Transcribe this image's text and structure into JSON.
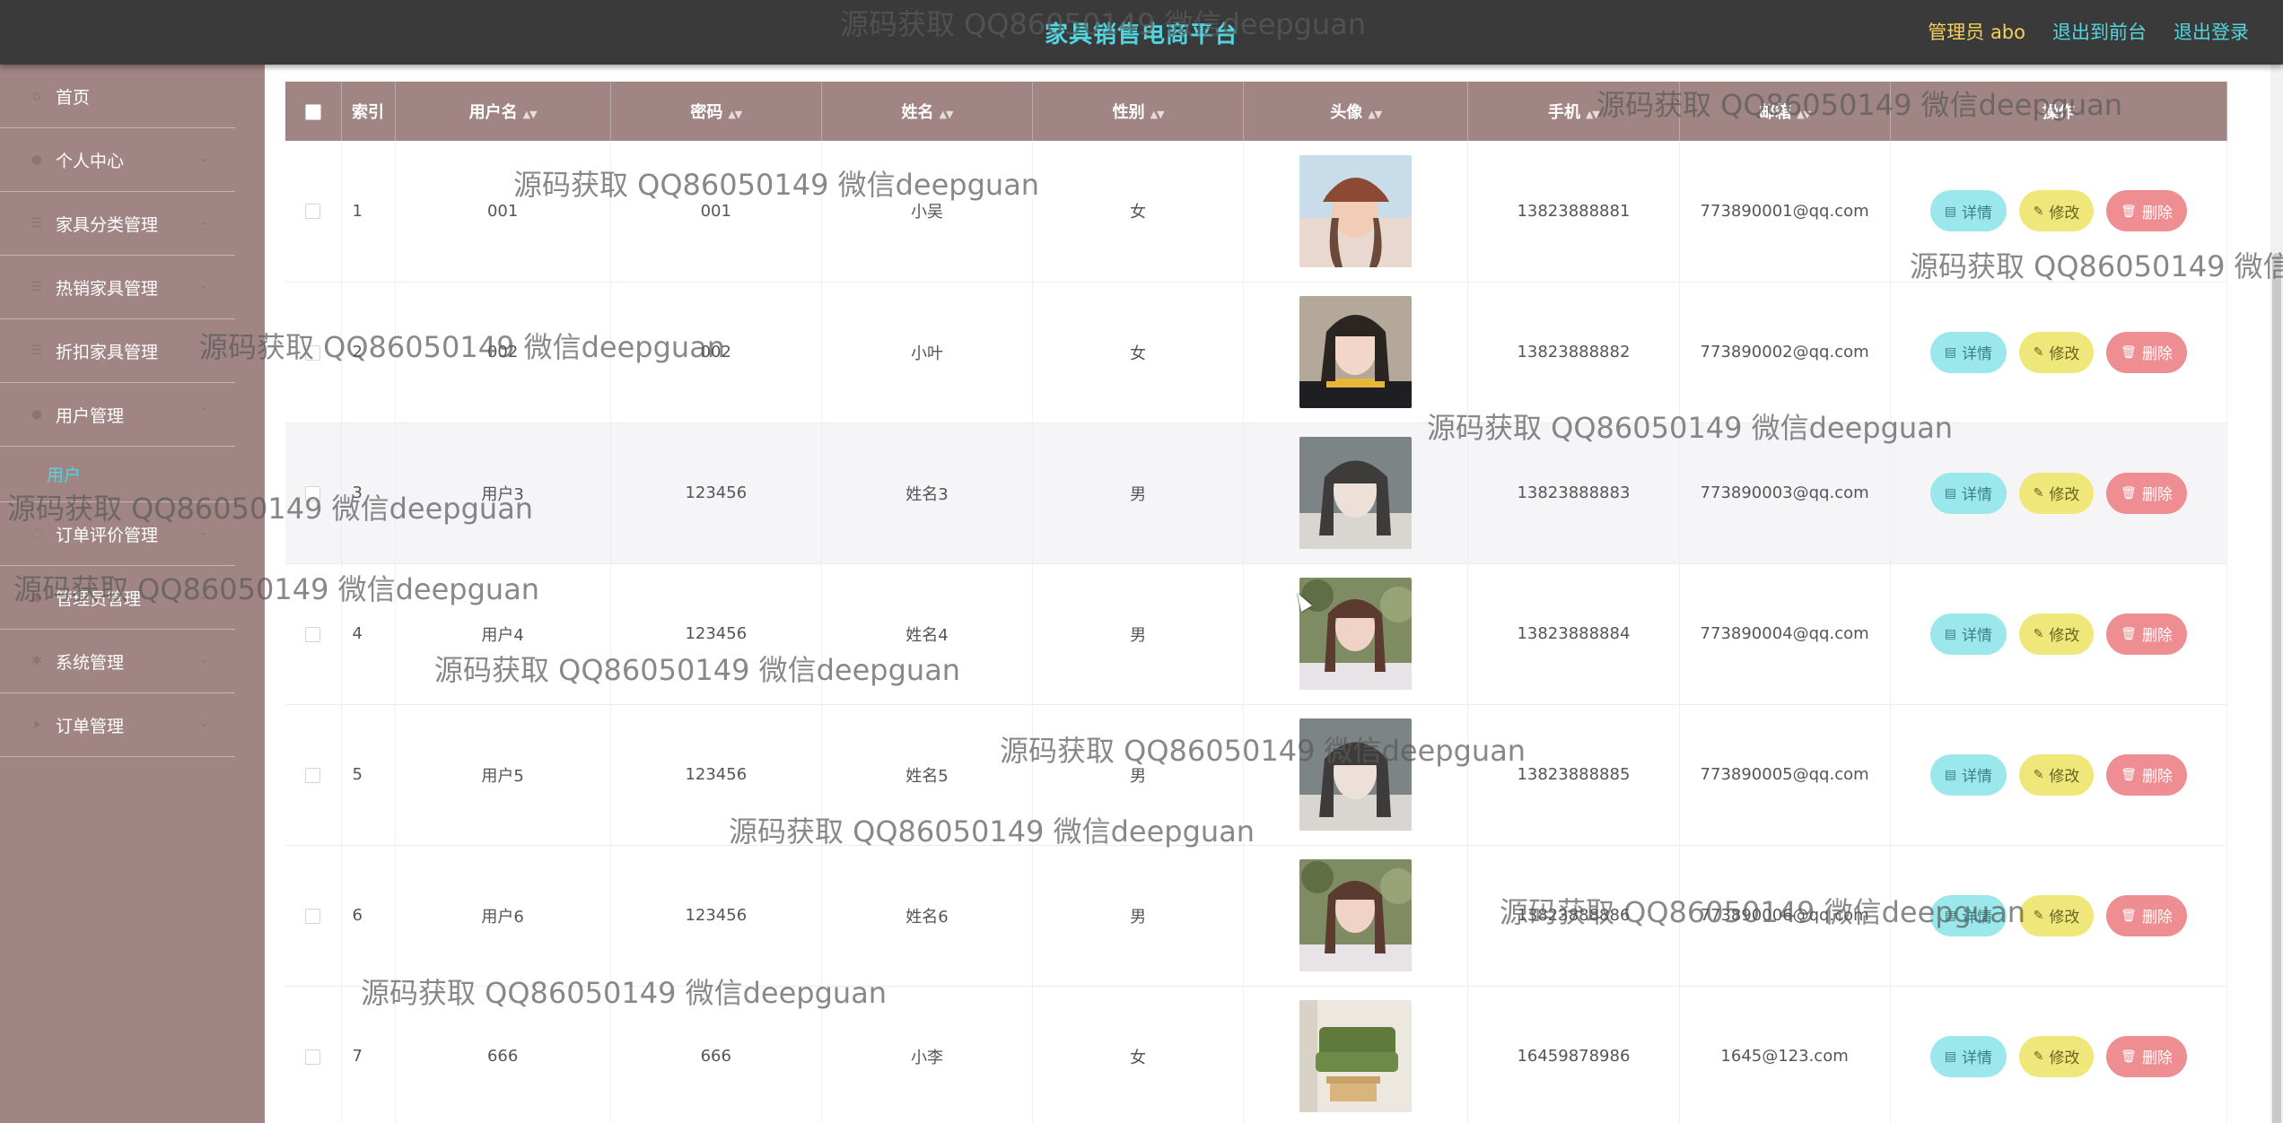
{
  "header": {
    "title": "家具销售电商平台",
    "role_label": "管理员 abo",
    "to_front": "退出到前台",
    "logout": "退出登录"
  },
  "sidebar": {
    "items": [
      {
        "label": "首页",
        "icon": "home-icon"
      },
      {
        "label": "个人中心",
        "icon": "user-icon"
      },
      {
        "label": "家具分类管理",
        "icon": "list-icon"
      },
      {
        "label": "热销家具管理",
        "icon": "list-icon"
      },
      {
        "label": "折扣家具管理",
        "icon": "list-icon"
      },
      {
        "label": "用户管理",
        "icon": "user-icon"
      },
      {
        "label": "用户",
        "icon": "",
        "sub": true
      },
      {
        "label": "订单评价管理",
        "icon": "comment-icon"
      },
      {
        "label": "管理员管理",
        "icon": "user-icon"
      },
      {
        "label": "系统管理",
        "icon": "gear-icon"
      },
      {
        "label": "订单管理",
        "icon": "send-icon"
      }
    ]
  },
  "table": {
    "headers": {
      "index": "索引",
      "username": "用户名",
      "password": "密码",
      "name": "姓名",
      "gender": "性别",
      "avatar": "头像",
      "phone": "手机",
      "email": "邮箱",
      "action": "操作"
    },
    "buttons": {
      "detail": "详情",
      "edit": "修改",
      "delete": "删除"
    },
    "rows": [
      {
        "index": "1",
        "username": "001",
        "password": "001",
        "name": "小吴",
        "gender": "女",
        "phone": "13823888881",
        "email": "773890001@qq.com",
        "avatar": "avatar-girl-cap"
      },
      {
        "index": "2",
        "username": "002",
        "password": "002",
        "name": "小叶",
        "gender": "女",
        "phone": "13823888882",
        "email": "773890002@qq.com",
        "avatar": "avatar-girl-dark"
      },
      {
        "index": "3",
        "username": "用户3",
        "password": "123456",
        "name": "姓名3",
        "gender": "男",
        "phone": "13823888883",
        "email": "773890003@qq.com",
        "avatar": "avatar-girl-grey"
      },
      {
        "index": "4",
        "username": "用户4",
        "password": "123456",
        "name": "姓名4",
        "gender": "男",
        "phone": "13823888884",
        "email": "773890004@qq.com",
        "avatar": "avatar-girl-garden"
      },
      {
        "index": "5",
        "username": "用户5",
        "password": "123456",
        "name": "姓名5",
        "gender": "男",
        "phone": "13823888885",
        "email": "773890005@qq.com",
        "avatar": "avatar-girl-grey"
      },
      {
        "index": "6",
        "username": "用户6",
        "password": "123456",
        "name": "姓名6",
        "gender": "男",
        "phone": "13823888886",
        "email": "773890006@qq.com",
        "avatar": "avatar-girl-garden"
      },
      {
        "index": "7",
        "username": "666",
        "password": "666",
        "name": "小李",
        "gender": "女",
        "phone": "16459878986",
        "email": "1645@123.com",
        "avatar": "avatar-sofa"
      }
    ]
  },
  "watermark": "源码获取 QQ86050149 微信deepguan",
  "watermark_cut": "源码获取 QQ86050149 微信de",
  "colors": {
    "sidebar": "#a08584",
    "accent": "#4fd6e0",
    "role": "#f5d25a",
    "detail_btn": "#9be8ec",
    "edit_btn": "#efe77a",
    "delete_btn": "#ef8e92"
  }
}
